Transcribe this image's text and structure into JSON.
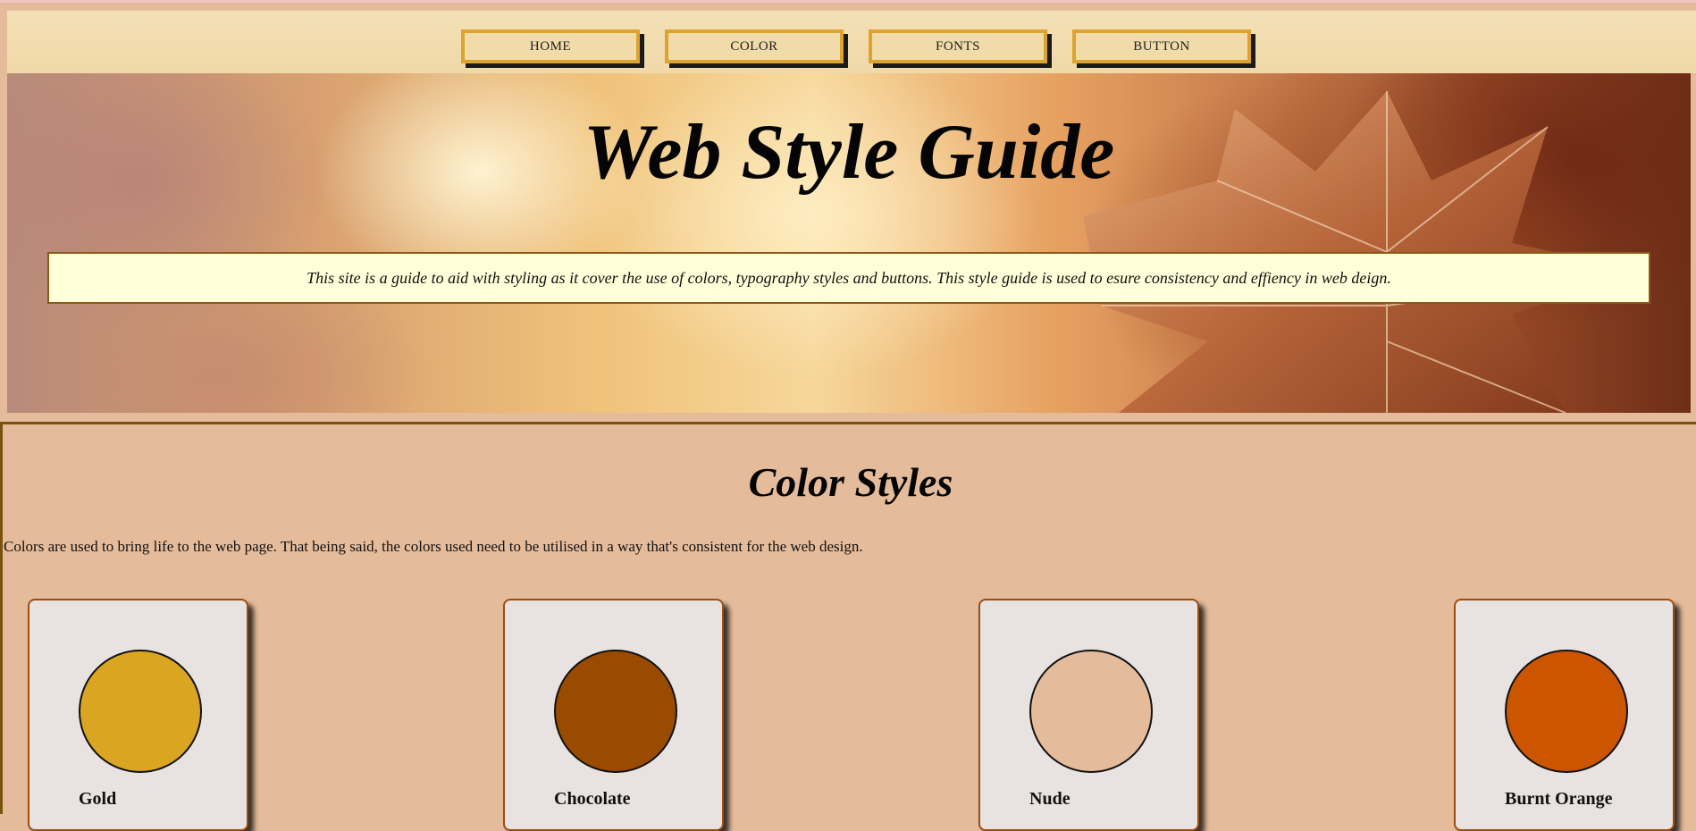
{
  "nav": {
    "items": [
      {
        "label": "HOME"
      },
      {
        "label": "COLOR"
      },
      {
        "label": "FONTS"
      },
      {
        "label": "BUTTON"
      }
    ]
  },
  "hero": {
    "title": "Web Style Guide",
    "intro": "This site is a guide to aid with styling as it cover the use of colors, typography styles and buttons. This style guide is used to esure consistency and effiency in web deign."
  },
  "color_section": {
    "title": "Color Styles",
    "description": "Colors are used to bring life to the web page. That being said, the colors used need to be utilised in a way that's consistent for the web design.",
    "swatches": [
      {
        "name": "Gold",
        "color": "#DAA520"
      },
      {
        "name": "Chocolate",
        "color": "#994C00"
      },
      {
        "name": "Nude",
        "color": "#E5BC9B"
      },
      {
        "name": "Burnt Orange",
        "color": "#CC5500"
      }
    ]
  }
}
